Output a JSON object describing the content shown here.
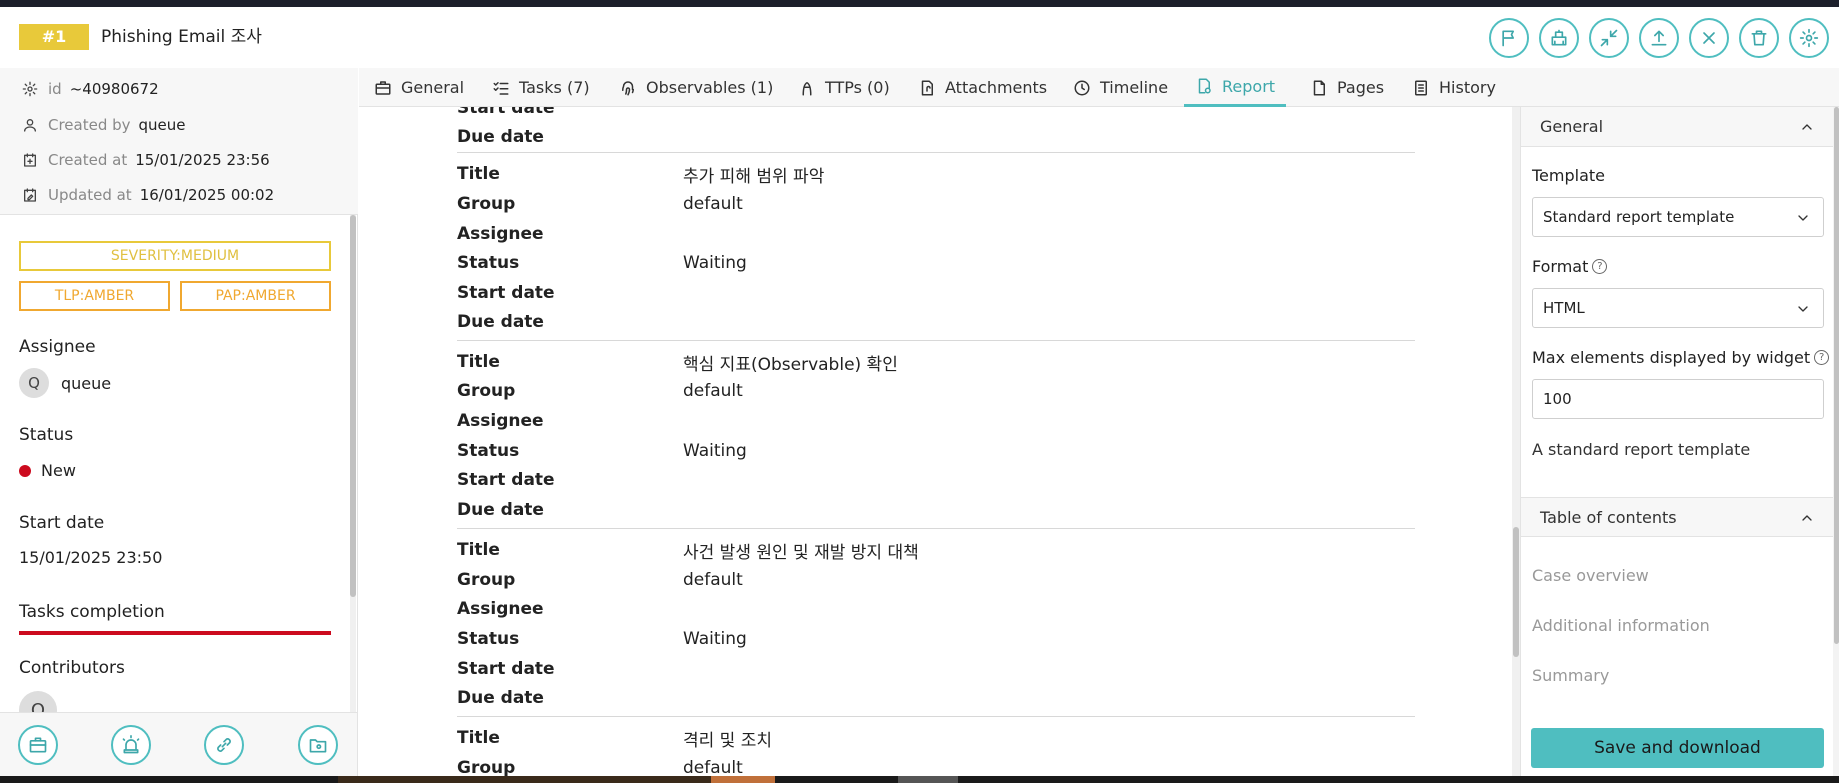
{
  "case": {
    "number": "#1",
    "title": "Phishing Email 조사"
  },
  "header_actions": [
    {
      "name": "flag-button",
      "icon": "flag-icon"
    },
    {
      "name": "merge-button",
      "icon": "merge-icon"
    },
    {
      "name": "collapse-button",
      "icon": "minimize-icon"
    },
    {
      "name": "export-button",
      "icon": "upload-icon"
    },
    {
      "name": "close-case-button",
      "icon": "close-icon"
    },
    {
      "name": "delete-button",
      "icon": "trash-icon"
    },
    {
      "name": "settings-button",
      "icon": "gear-icon"
    }
  ],
  "meta": {
    "id_label": "id",
    "id_value": "~40980672",
    "created_by_label": "Created by",
    "created_by_value": "queue",
    "created_at_label": "Created at",
    "created_at_value": "15/01/2025 23:56",
    "updated_at_label": "Updated at",
    "updated_at_value": "16/01/2025 00:02"
  },
  "tags": {
    "severity": "SEVERITY:MEDIUM",
    "tlp": "TLP:AMBER",
    "pap": "PAP:AMBER"
  },
  "details": {
    "assignee_label": "Assignee",
    "assignee_initial": "Q",
    "assignee_name": "queue",
    "status_label": "Status",
    "status_value": "New",
    "start_date_label": "Start date",
    "start_date_value": "15/01/2025 23:50",
    "tasks_completion_label": "Tasks completion",
    "contributors_label": "Contributors",
    "contributor_initial": "Q"
  },
  "footer_actions": [
    {
      "name": "case-button",
      "icon": "briefcase-icon"
    },
    {
      "name": "alert-button",
      "icon": "siren-icon"
    },
    {
      "name": "link-button",
      "icon": "link-icon"
    },
    {
      "name": "folder-settings-button",
      "icon": "folder-gear-icon"
    }
  ],
  "tabs": [
    {
      "label": "General",
      "icon": "briefcase-icon"
    },
    {
      "label": "Tasks (7)",
      "icon": "tasks-icon"
    },
    {
      "label": "Observables (1)",
      "icon": "fingerprint-icon"
    },
    {
      "label": "TTPs (0)",
      "icon": "ninja-icon"
    },
    {
      "label": "Attachments",
      "icon": "attachment-icon"
    },
    {
      "label": "Timeline",
      "icon": "clock-icon"
    },
    {
      "label": "Report",
      "icon": "report-icon",
      "active": true
    },
    {
      "label": "Pages",
      "icon": "page-icon"
    },
    {
      "label": "History",
      "icon": "history-icon"
    }
  ],
  "report": {
    "labels": {
      "title": "Title",
      "group": "Group",
      "assignee": "Assignee",
      "status": "Status",
      "start_date": "Start date",
      "due_date": "Due date"
    },
    "tasks": [
      {
        "title": "추가 피해 범위 파악",
        "group": "default",
        "assignee": "",
        "status": "Waiting",
        "start_date": "",
        "due_date": ""
      },
      {
        "title": "핵심 지표(Observable) 확인",
        "group": "default",
        "assignee": "",
        "status": "Waiting",
        "start_date": "",
        "due_date": ""
      },
      {
        "title": "사건 발생 원인 및 재발 방지 대책",
        "group": "default",
        "assignee": "",
        "status": "Waiting",
        "start_date": "",
        "due_date": ""
      },
      {
        "title": "격리 및 조치",
        "group": "default"
      }
    ]
  },
  "right_panel": {
    "general_header": "General",
    "template_label": "Template",
    "template_value": "Standard report template",
    "format_label": "Format",
    "format_value": "HTML",
    "max_label": "Max elements displayed by widget",
    "max_value": "100",
    "description": "A standard report template",
    "toc_header": "Table of contents",
    "toc_items": [
      "Case overview",
      "Additional information",
      "Summary"
    ],
    "save_label": "Save and download"
  },
  "colors": {
    "accent": "#4fbec0",
    "tag_amber": "#f0a830",
    "tag_yellow": "#e8c93a",
    "status_new": "#cc0a1e"
  }
}
